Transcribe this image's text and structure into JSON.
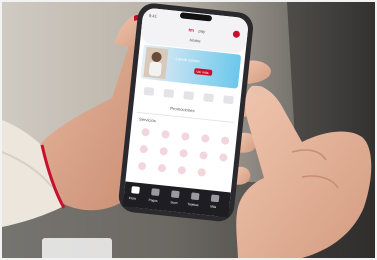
{
  "photo": {
    "subject": "hands-holding-smartphone",
    "colors": {
      "background": "#b9b3aa",
      "sleeve": "#ece6dc",
      "skin": "#d9a58a",
      "bracelet": "#c8102e",
      "phone_frame": "#2a2a2e",
      "app_accent": "#c8102e",
      "banner": "#7fd0f0"
    }
  },
  "phone": {
    "status_time": "9:41",
    "app_logo": "tm",
    "logo_suffix": "pay",
    "header_subtitle": "Home",
    "banner_text": "Lorem ipsum",
    "banner_button": "Ver más",
    "promo_link": "Promociones",
    "section_title": "Servicios",
    "bottom_nav": [
      "Inicio",
      "Pagos",
      "Scan",
      "Tarjetas",
      "Más"
    ]
  }
}
